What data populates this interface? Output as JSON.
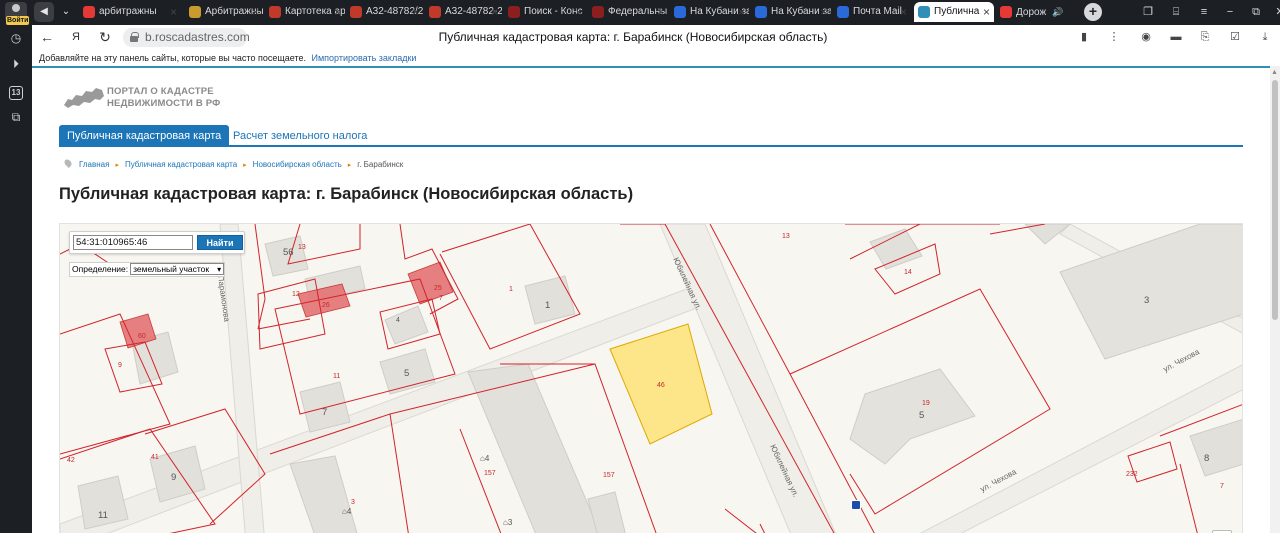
{
  "browser": {
    "login_label": "Войти",
    "tabs": [
      {
        "label": "арбитражны",
        "color": "#e53935"
      },
      {
        "label": "Арбитражны",
        "color": "#c99a2e"
      },
      {
        "label": "Картотека ар",
        "color": "#c0392b"
      },
      {
        "label": "А32-48782/2",
        "color": "#c0392b"
      },
      {
        "label": "А32-48782-2",
        "color": "#c0392b"
      },
      {
        "label": "Поиск - Конс",
        "color": "#8b1e1e"
      },
      {
        "label": "Федеральны",
        "color": "#8b1e1e"
      },
      {
        "label": "На Кубани за",
        "color": "#2a6ad8"
      },
      {
        "label": "На Кубани за",
        "color": "#2a6ad8"
      },
      {
        "label": "Почта Mail",
        "color": "#2a6ad8"
      },
      {
        "label": "Публична",
        "color": "#2f8fb8"
      },
      {
        "label": "Дорож",
        "color": "#e53935"
      }
    ],
    "active_tab_index": 10,
    "domain": "b.roscadastres.com",
    "page_title": "Публичная кадастровая карта: г. Барабинск (Новосибирская область)",
    "bookmarks_hint": "Добавляйте на эту панель сайты, которые вы часто посещаете.",
    "bookmarks_import": "Импортировать закладки",
    "rail_badge": "13"
  },
  "site": {
    "logo_line1": "ПОРТАЛ О КАДАСТРЕ",
    "logo_line2": "НЕДВИЖИМОСТИ В РФ",
    "nav_active": "Публичная кадастровая карта",
    "nav_link": "Расчет земельного налога",
    "breadcrumbs": [
      "Главная",
      "Публичная кадастровая карта",
      "Новосибирская область",
      "г. Барабинск"
    ],
    "heading": "Публичная кадастровая карта: г. Барабинск (Новосибирская область)"
  },
  "map": {
    "search_value": "54:31:010965:46",
    "find_label": "Найти",
    "definition_label": "Определение:",
    "definition_value": "земельный участок",
    "street_labels": [
      "Юбилейная ул.",
      "Юбилейная ул.",
      "ул. Чехова",
      "ул. Чехова",
      "Парамонова"
    ],
    "building_numbers": [
      "56",
      "1",
      "4",
      "5",
      "7",
      "9",
      "11",
      "3",
      "5",
      "8"
    ],
    "parcel_numbers": [
      "13",
      "12",
      "26",
      "25",
      "7",
      "1",
      "60",
      "9",
      "11",
      "42",
      "41",
      "14",
      "19",
      "46",
      "157",
      "157",
      "3",
      "232",
      "7",
      "13"
    ],
    "house_icons": [
      "4",
      "4",
      "3"
    ],
    "colors": {
      "parcel_line": "#d2232a",
      "selected_fill": "#fde68a",
      "building": "#e4e2dd",
      "ownership_fill": "#e57373"
    }
  }
}
